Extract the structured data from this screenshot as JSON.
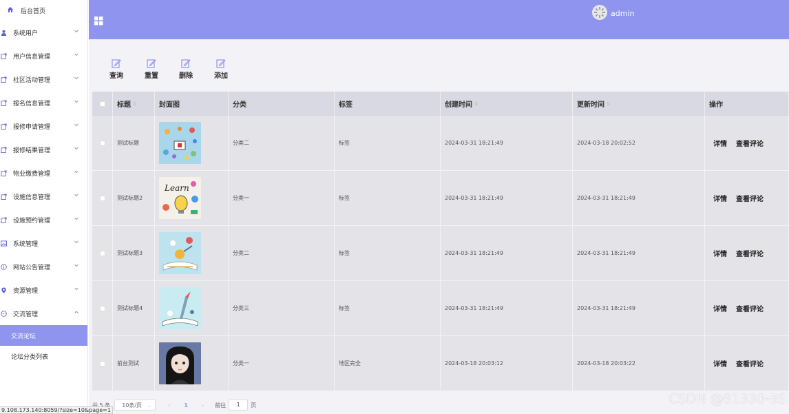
{
  "sidebar": {
    "home_label": "后台首页",
    "items": [
      {
        "label": "系统用户",
        "icon": "user-icon",
        "expanded": false
      },
      {
        "label": "用户信息管理",
        "icon": "doc-icon",
        "expanded": false
      },
      {
        "label": "社区活动管理",
        "icon": "doc-icon",
        "expanded": false
      },
      {
        "label": "报名信息管理",
        "icon": "doc-icon",
        "expanded": false
      },
      {
        "label": "报修申请管理",
        "icon": "doc-icon",
        "expanded": false
      },
      {
        "label": "报修结果管理",
        "icon": "doc-icon",
        "expanded": false
      },
      {
        "label": "物业缴费管理",
        "icon": "doc-icon",
        "expanded": false
      },
      {
        "label": "设施信息管理",
        "icon": "doc-icon",
        "expanded": false
      },
      {
        "label": "设施预约管理",
        "icon": "doc-icon",
        "expanded": false
      },
      {
        "label": "系统管理",
        "icon": "image-icon",
        "expanded": false
      },
      {
        "label": "网站公告管理",
        "icon": "info-icon",
        "expanded": false
      },
      {
        "label": "资源管理",
        "icon": "location-icon",
        "expanded": false
      },
      {
        "label": "交流管理",
        "icon": "chat-icon",
        "expanded": true
      }
    ],
    "sub_items": [
      {
        "label": "交流论坛",
        "active": true
      },
      {
        "label": "论坛分类列表",
        "active": false
      }
    ]
  },
  "header": {
    "user_name": "admin",
    "accent": "#8f94ee"
  },
  "toolbar": {
    "query": "查询",
    "reset": "重置",
    "delete": "删除",
    "add": "添加"
  },
  "table": {
    "headers": {
      "title": "标题",
      "cover": "封面图",
      "category": "分类",
      "tag": "标签",
      "created": "创建时间",
      "updated": "更新时间",
      "actions": "操作"
    },
    "rows": [
      {
        "title": "测试标题",
        "category": "分类二",
        "tag": "标签",
        "created": "2024-03-31 18:21:49",
        "updated": "2024-03-18 20:02:52",
        "cover": "cover-1"
      },
      {
        "title": "测试标题2",
        "category": "分类一",
        "tag": "标签",
        "created": "2024-03-31 18:21:49",
        "updated": "2024-03-31 18:21:49",
        "cover": "cover-2"
      },
      {
        "title": "测试标题3",
        "category": "分类二",
        "tag": "标签",
        "created": "2024-03-31 18:21:49",
        "updated": "2024-03-31 18:21:49",
        "cover": "cover-3"
      },
      {
        "title": "测试标题4",
        "category": "分类三",
        "tag": "标签",
        "created": "2024-03-31 18:21:49",
        "updated": "2024-03-31 18:21:49",
        "cover": "cover-4"
      },
      {
        "title": "前台测试",
        "category": "分类一",
        "tag": "地区完全",
        "created": "2024-03-18 20:03:12",
        "updated": "2024-03-18 20:03:22",
        "cover": "cover-5"
      }
    ],
    "action_detail": "详情",
    "action_comments": "查看评论"
  },
  "pagination": {
    "total": "共 5 条",
    "page_size": "10条/页",
    "current_page": "1",
    "goto_prefix": "前往",
    "goto_value": "1",
    "goto_suffix": "页"
  },
  "status_url": "9.108.173.140:8059/?size=10&page=1",
  "watermark": "CSDN @81330-BS"
}
